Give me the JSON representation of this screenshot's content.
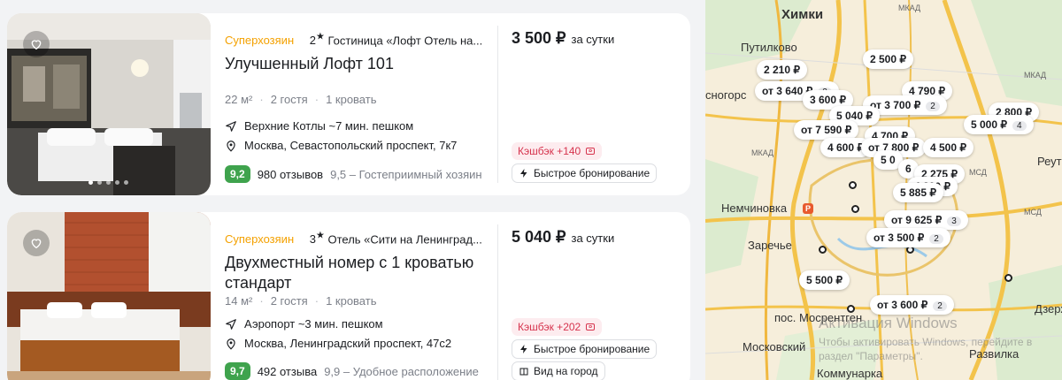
{
  "listings": [
    {
      "superhost": "Суперхозяин",
      "stars": "2",
      "hotel": "Гостиница «Лофт Отель на...",
      "title": "Улучшенный Лофт 101",
      "area": "22 м²",
      "guests": "2 гостя",
      "beds": "1 кровать",
      "metro": "Верхние Котлы ~7 мин. пешком",
      "address": "Москва, Севастопольский проспект, 7к7",
      "score": "9,2",
      "reviews": "980 отзывов",
      "host_rating": "9,5 – Гостеприимный хозяин",
      "price": "3 500 ₽",
      "per": "за сутки",
      "cashback": "Кэшбэк +140",
      "options": [
        "Быстрое бронирование"
      ]
    },
    {
      "superhost": "Суперхозяин",
      "stars": "3",
      "hotel": "Отель «Сити на Ленинград...",
      "title": "Двухместный номер с 1 кроватью стандарт",
      "area": "14 м²",
      "guests": "2 гостя",
      "beds": "1 кровать",
      "metro": "Аэропорт ~3 мин. пешком",
      "address": "Москва, Ленинградский проспект, 47с2",
      "score": "9,7",
      "reviews": "492 отзыва",
      "host_rating": "9,9 – Удобное расположение",
      "price": "5 040 ₽",
      "per": "за сутки",
      "cashback": "Кэшбэк +202",
      "options": [
        "Быстрое бронирование",
        "Вид на город"
      ]
    }
  ],
  "map": {
    "labels": {
      "khimki": "Химки",
      "putilkovo": "Путилково",
      "krasnogorsk": "сногорс",
      "nemchinovka": "Немчиновка",
      "zarechye": "Заречье",
      "mosrentgen": "пос. Мосрентген",
      "moskovsky": "Московский",
      "kommunarka": "Коммунарка",
      "razvilka": "Развилка",
      "dzerzh": "Дзерж",
      "reut": "Реут",
      "mkad": "МКАД",
      "msd": "МСД"
    },
    "pins": [
      {
        "text": "2 500 ₽",
        "count": ""
      },
      {
        "text": "2 210 ₽",
        "count": ""
      },
      {
        "text": "от 3 640 ₽",
        "count": "2"
      },
      {
        "text": "4 790 ₽",
        "count": ""
      },
      {
        "text": "3 600 ₽",
        "count": ""
      },
      {
        "text": "от 3 700 ₽",
        "count": "2"
      },
      {
        "text": "2 800 ₽",
        "count": ""
      },
      {
        "text": "5 040 ₽",
        "count": ""
      },
      {
        "text": "5 000 ₽",
        "count": "4"
      },
      {
        "text": "от 7 590 ₽",
        "count": ""
      },
      {
        "text": "4 700 ₽",
        "count": ""
      },
      {
        "text": "4 600 ₽",
        "count": ""
      },
      {
        "text": "от 7 800 ₽",
        "count": ""
      },
      {
        "text": "4 500 ₽",
        "count": ""
      },
      {
        "text": "5 0",
        "count": ""
      },
      {
        "text": "6",
        "count": ""
      },
      {
        "text": "2 275 ₽",
        "count": ""
      },
      {
        "text": "4 200 ₽",
        "count": ""
      },
      {
        "text": "5 885 ₽",
        "count": ""
      },
      {
        "text": "от 9 625 ₽",
        "count": "3"
      },
      {
        "text": "от 3 500 ₽",
        "count": "2"
      },
      {
        "text": "5 500 ₽",
        "count": ""
      },
      {
        "text": "от 3 600 ₽",
        "count": "2"
      }
    ],
    "watermark_line1": "Активация Windows",
    "watermark_line2": "Чтобы активировать Windows, перейдите в",
    "watermark_line3": "раздел \"Параметры\"."
  }
}
